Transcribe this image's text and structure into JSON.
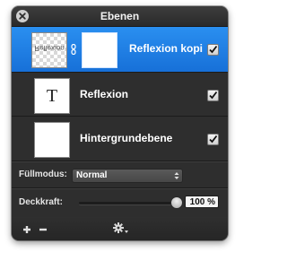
{
  "window": {
    "title": "Ebenen"
  },
  "layers": [
    {
      "name": "Reflexion kopi",
      "visible": true,
      "selected": true,
      "thumb_text": "Reflexion"
    },
    {
      "name": "Reflexion",
      "visible": true,
      "selected": false,
      "thumb_glyph": "T"
    },
    {
      "name": "Hintergrundebene",
      "visible": true,
      "selected": false
    }
  ],
  "controls": {
    "blend_mode_label": "Füllmodus:",
    "blend_mode_value": "Normal",
    "opacity_label": "Deckkraft:",
    "opacity_value": "100 %",
    "opacity_level": 1.0
  },
  "toolbar": {
    "add_icon": "plus-icon",
    "remove_icon": "minus-icon",
    "actions_icon": "gear-icon"
  },
  "colors": {
    "panel_bg": "#2e2e2e",
    "selection": "#1f80e6",
    "text": "#ffffff"
  }
}
